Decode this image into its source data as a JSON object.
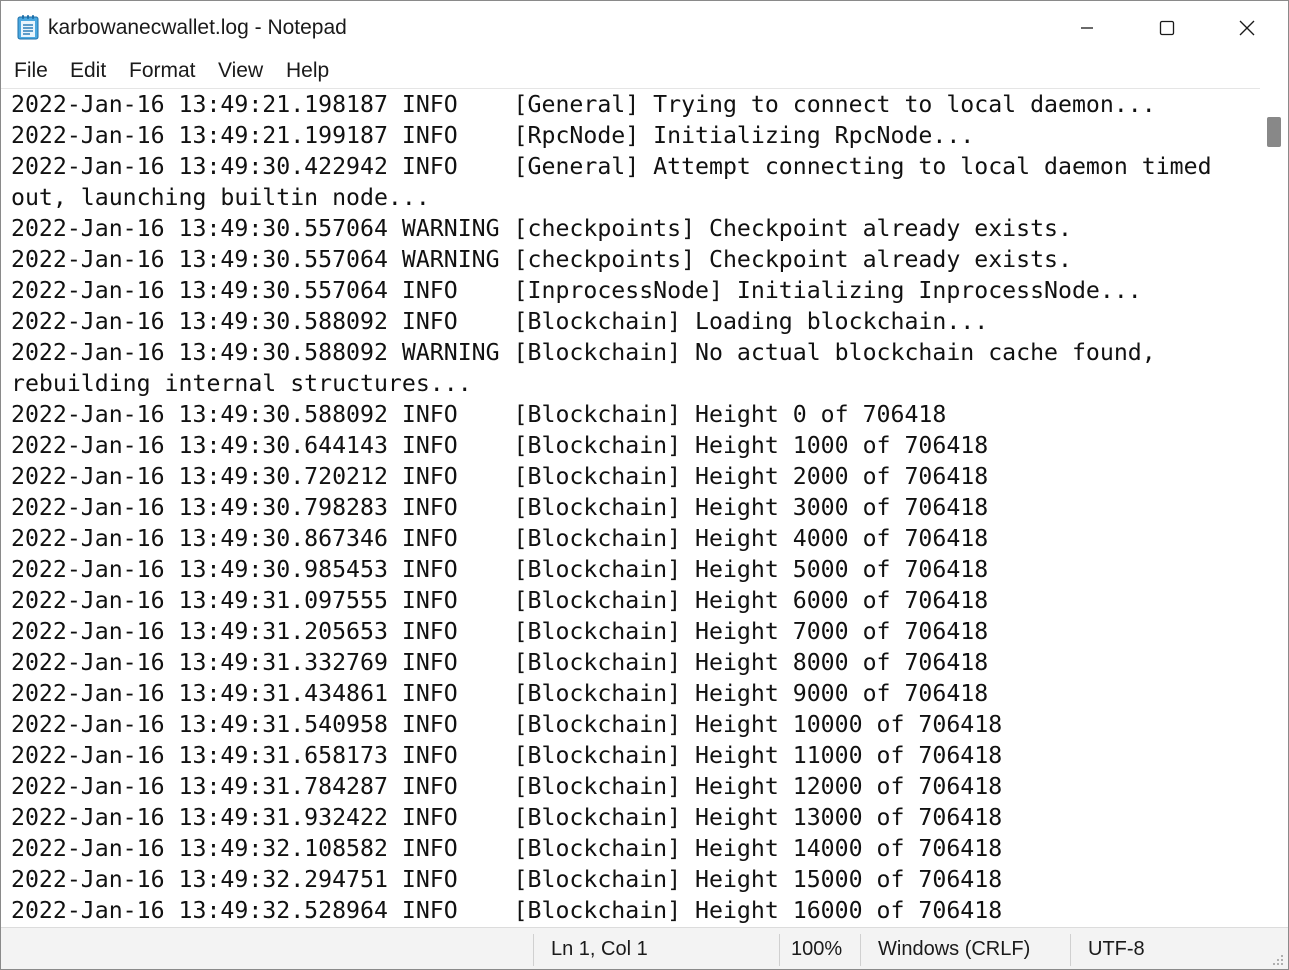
{
  "window": {
    "title": "karbowanecwallet.log - Notepad",
    "icon": "notepad-icon"
  },
  "controls": {
    "minimize_icon": "minimize-icon",
    "maximize_icon": "maximize-icon",
    "close_icon": "close-icon"
  },
  "menu": {
    "items": [
      {
        "label": "File"
      },
      {
        "label": "Edit"
      },
      {
        "label": "Format"
      },
      {
        "label": "View"
      },
      {
        "label": "Help"
      }
    ]
  },
  "editor": {
    "lines": [
      "2022-Jan-16 13:49:21.198187 INFO    [General] Trying to connect to local daemon...",
      "2022-Jan-16 13:49:21.199187 INFO    [RpcNode] Initializing RpcNode...",
      "2022-Jan-16 13:49:30.422942 INFO    [General] Attempt connecting to local daemon timed",
      "out, launching builtin node...",
      "2022-Jan-16 13:49:30.557064 WARNING [checkpoints] Checkpoint already exists.",
      "2022-Jan-16 13:49:30.557064 WARNING [checkpoints] Checkpoint already exists.",
      "2022-Jan-16 13:49:30.557064 INFO    [InprocessNode] Initializing InprocessNode...",
      "2022-Jan-16 13:49:30.588092 INFO    [Blockchain] Loading blockchain...",
      "2022-Jan-16 13:49:30.588092 WARNING [Blockchain] No actual blockchain cache found,",
      "rebuilding internal structures...",
      "2022-Jan-16 13:49:30.588092 INFO    [Blockchain] Height 0 of 706418",
      "2022-Jan-16 13:49:30.644143 INFO    [Blockchain] Height 1000 of 706418",
      "2022-Jan-16 13:49:30.720212 INFO    [Blockchain] Height 2000 of 706418",
      "2022-Jan-16 13:49:30.798283 INFO    [Blockchain] Height 3000 of 706418",
      "2022-Jan-16 13:49:30.867346 INFO    [Blockchain] Height 4000 of 706418",
      "2022-Jan-16 13:49:30.985453 INFO    [Blockchain] Height 5000 of 706418",
      "2022-Jan-16 13:49:31.097555 INFO    [Blockchain] Height 6000 of 706418",
      "2022-Jan-16 13:49:31.205653 INFO    [Blockchain] Height 7000 of 706418",
      "2022-Jan-16 13:49:31.332769 INFO    [Blockchain] Height 8000 of 706418",
      "2022-Jan-16 13:49:31.434861 INFO    [Blockchain] Height 9000 of 706418",
      "2022-Jan-16 13:49:31.540958 INFO    [Blockchain] Height 10000 of 706418",
      "2022-Jan-16 13:49:31.658173 INFO    [Blockchain] Height 11000 of 706418",
      "2022-Jan-16 13:49:31.784287 INFO    [Blockchain] Height 12000 of 706418",
      "2022-Jan-16 13:49:31.932422 INFO    [Blockchain] Height 13000 of 706418",
      "2022-Jan-16 13:49:32.108582 INFO    [Blockchain] Height 14000 of 706418",
      "2022-Jan-16 13:49:32.294751 INFO    [Blockchain] Height 15000 of 706418",
      "2022-Jan-16 13:49:32.528964 INFO    [Blockchain] Height 16000 of 706418"
    ]
  },
  "status": {
    "position": "Ln 1, Col 1",
    "zoom": "100%",
    "line_ending": "Windows (CRLF)",
    "encoding": "UTF-8"
  },
  "colors": {
    "accent_icon": "#2f9ad6",
    "status_bg": "#f3f3f3",
    "scroll_thumb": "#888888"
  }
}
